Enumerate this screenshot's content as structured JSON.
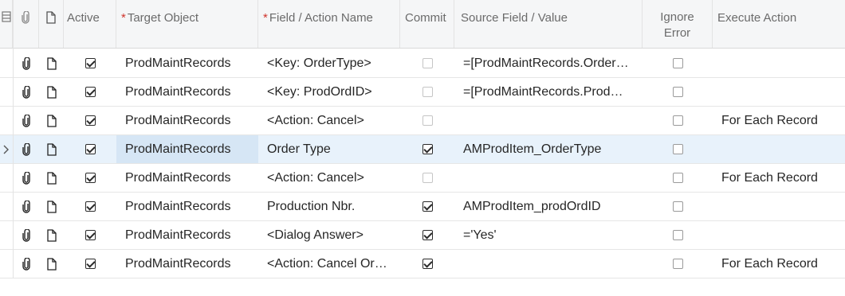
{
  "header": {
    "active": "Active",
    "target_object": "Target Object",
    "field_action_name": "Field / Action Name",
    "commit": "Commit",
    "source_field_value": "Source Field / Value",
    "ignore_error_1": "Ignore",
    "ignore_error_2": "Error",
    "execute_action": "Execute Action",
    "required_mark": "*"
  },
  "rows": [
    {
      "active": true,
      "target": "ProdMaintRecords",
      "field": "<Key: OrderType>",
      "commit": false,
      "commit_enabled": false,
      "source": "=[ProdMaintRecords.Order…",
      "ignore_error": false,
      "execute": ""
    },
    {
      "active": true,
      "target": "ProdMaintRecords",
      "field": "<Key: ProdOrdID>",
      "commit": false,
      "commit_enabled": false,
      "source": "=[ProdMaintRecords.Prod…",
      "ignore_error": false,
      "execute": ""
    },
    {
      "active": true,
      "target": "ProdMaintRecords",
      "field": "<Action: Cancel>",
      "commit": false,
      "commit_enabled": false,
      "source": "",
      "ignore_error": false,
      "execute": "For Each Record"
    },
    {
      "active": true,
      "target": "ProdMaintRecords",
      "field": "Order Type",
      "commit": true,
      "commit_enabled": true,
      "source": "AMProdItem_OrderType",
      "ignore_error": false,
      "execute": "",
      "selected": true
    },
    {
      "active": true,
      "target": "ProdMaintRecords",
      "field": "<Action: Cancel>",
      "commit": false,
      "commit_enabled": false,
      "source": "",
      "ignore_error": false,
      "execute": "For Each Record"
    },
    {
      "active": true,
      "target": "ProdMaintRecords",
      "field": "Production Nbr.",
      "commit": true,
      "commit_enabled": true,
      "source": "AMProdItem_prodOrdID",
      "ignore_error": false,
      "execute": ""
    },
    {
      "active": true,
      "target": "ProdMaintRecords",
      "field": "<Dialog Answer>",
      "commit": true,
      "commit_enabled": true,
      "source": "='Yes'",
      "ignore_error": false,
      "execute": ""
    },
    {
      "active": true,
      "target": "ProdMaintRecords",
      "field": "<Action: Cancel Or…",
      "commit": true,
      "commit_enabled": true,
      "source": "",
      "ignore_error": false,
      "execute": "For Each Record"
    }
  ]
}
